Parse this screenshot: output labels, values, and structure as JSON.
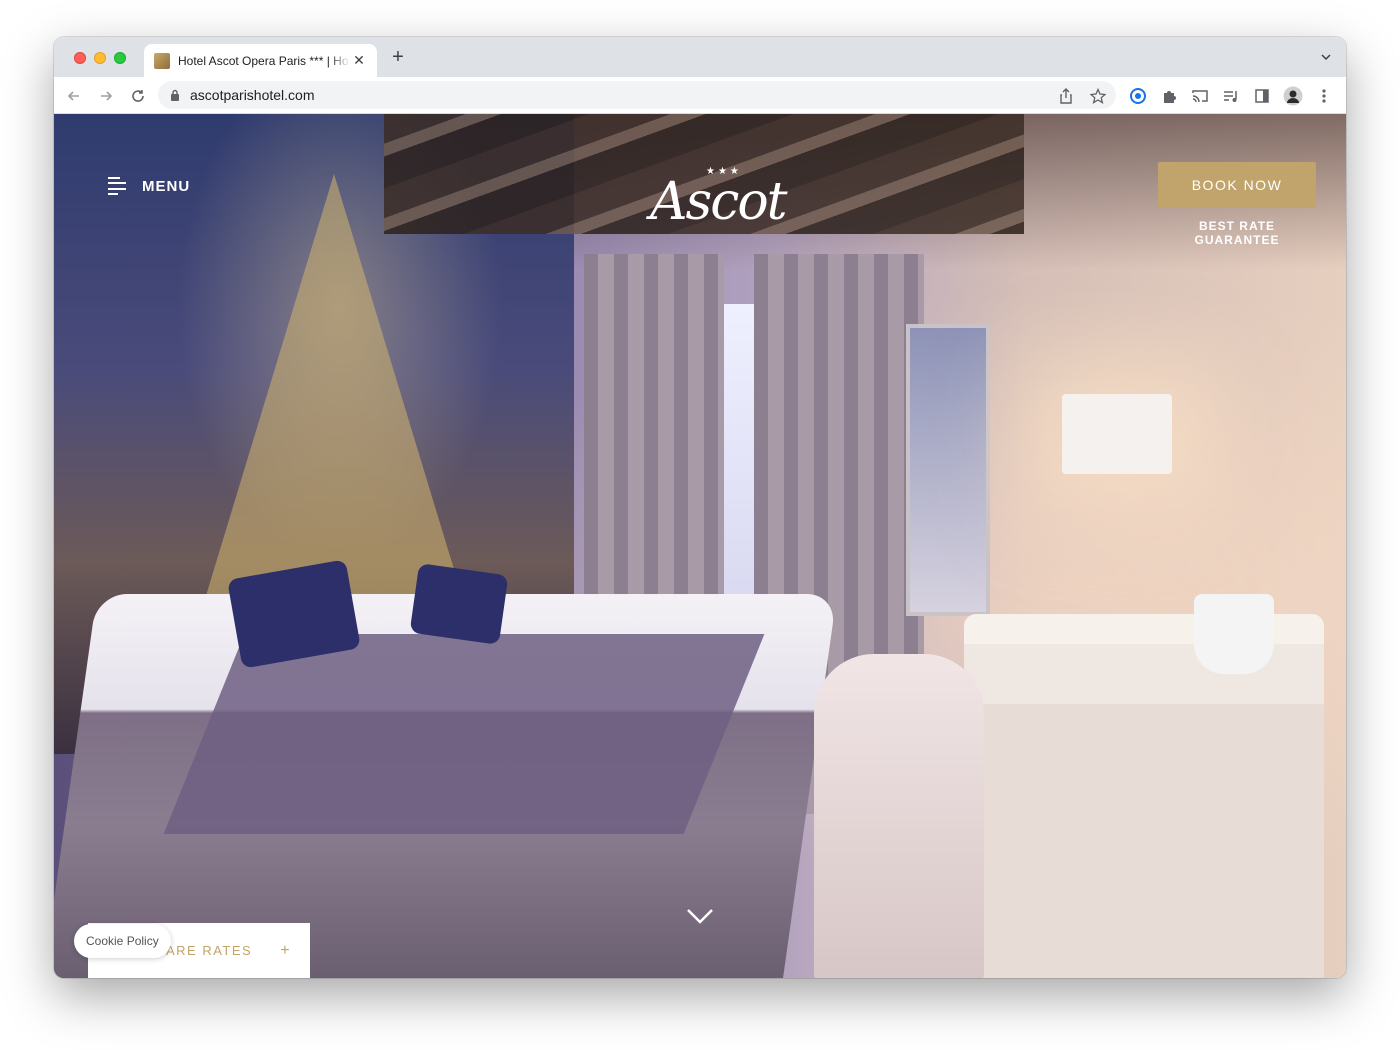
{
  "browser": {
    "tab_title": "Hotel Ascot Opera Paris *** | Hotel",
    "url": "ascotparishotel.com"
  },
  "site": {
    "menu_label": "MENU",
    "logo_text": "Ascot",
    "logo_stars": "★★★",
    "book_now_label": "BOOK NOW",
    "best_rate_label": "BEST RATE GUARANTEE",
    "compare_rates_label": "ARE RATES",
    "compare_plus": "+",
    "cookie_policy_label": "Cookie Policy"
  },
  "colors": {
    "accent_gold": "#c0a46b",
    "tab_strip": "#dee1e6"
  }
}
